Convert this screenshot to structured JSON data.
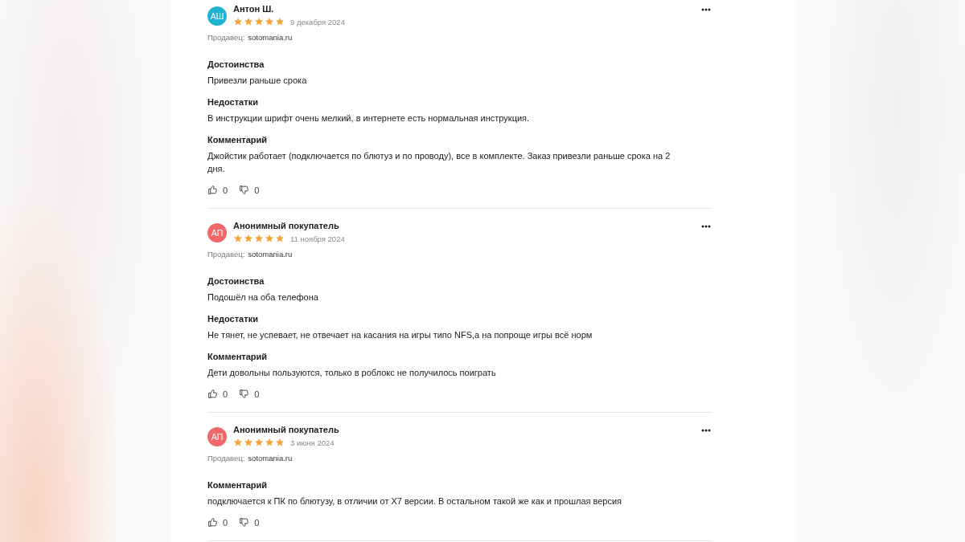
{
  "reviews": [
    {
      "initials": "АШ",
      "color": "#1fb3d1",
      "author": "Антон Ш.",
      "stars": 5,
      "date": "9 декабря 2024",
      "seller_label": "Продавец:",
      "seller": "sotomania.ru",
      "sections": [
        {
          "title": "Достоинства",
          "text": "Привезли раньше срока"
        },
        {
          "title": "Недостатки",
          "text": "В инструкции шрифт очень мелкий, в интернете есть нормальная инструкция."
        },
        {
          "title": "Комментарий",
          "text": "Джойстик работает (подключается по блютуз и по проводу), все в комплекте. Заказ привезли раньше срока на 2 дня."
        }
      ],
      "likes": "0",
      "dislikes": "0"
    },
    {
      "initials": "АП",
      "color": "#f06868",
      "author": "Анонимный покупатель",
      "stars": 5,
      "date": "11 ноября 2024",
      "seller_label": "Продавец:",
      "seller": "sotomania.ru",
      "sections": [
        {
          "title": "Достоинства",
          "text": "Подошёл на оба телефона"
        },
        {
          "title": "Недостатки",
          "text": "Не тянет, не успевает, не отвечает на касания на игры типо NFS,а на попроще игры всё норм"
        },
        {
          "title": "Комментарий",
          "text": "Дети довольны пользуются, только в роблокс не получилось поиграть"
        }
      ],
      "likes": "0",
      "dislikes": "0"
    },
    {
      "initials": "АП",
      "color": "#f06868",
      "author": "Анонимный покупатель",
      "stars": 5,
      "date": "3 июня 2024",
      "seller_label": "Продавец:",
      "seller": "sotomania.ru",
      "sections": [
        {
          "title": "Комментарий",
          "text": "подключается к ПК по блютузу, в отличии от X7 версии. В остальном такой же как и прошлая версия"
        }
      ],
      "likes": "0",
      "dislikes": "0"
    }
  ]
}
